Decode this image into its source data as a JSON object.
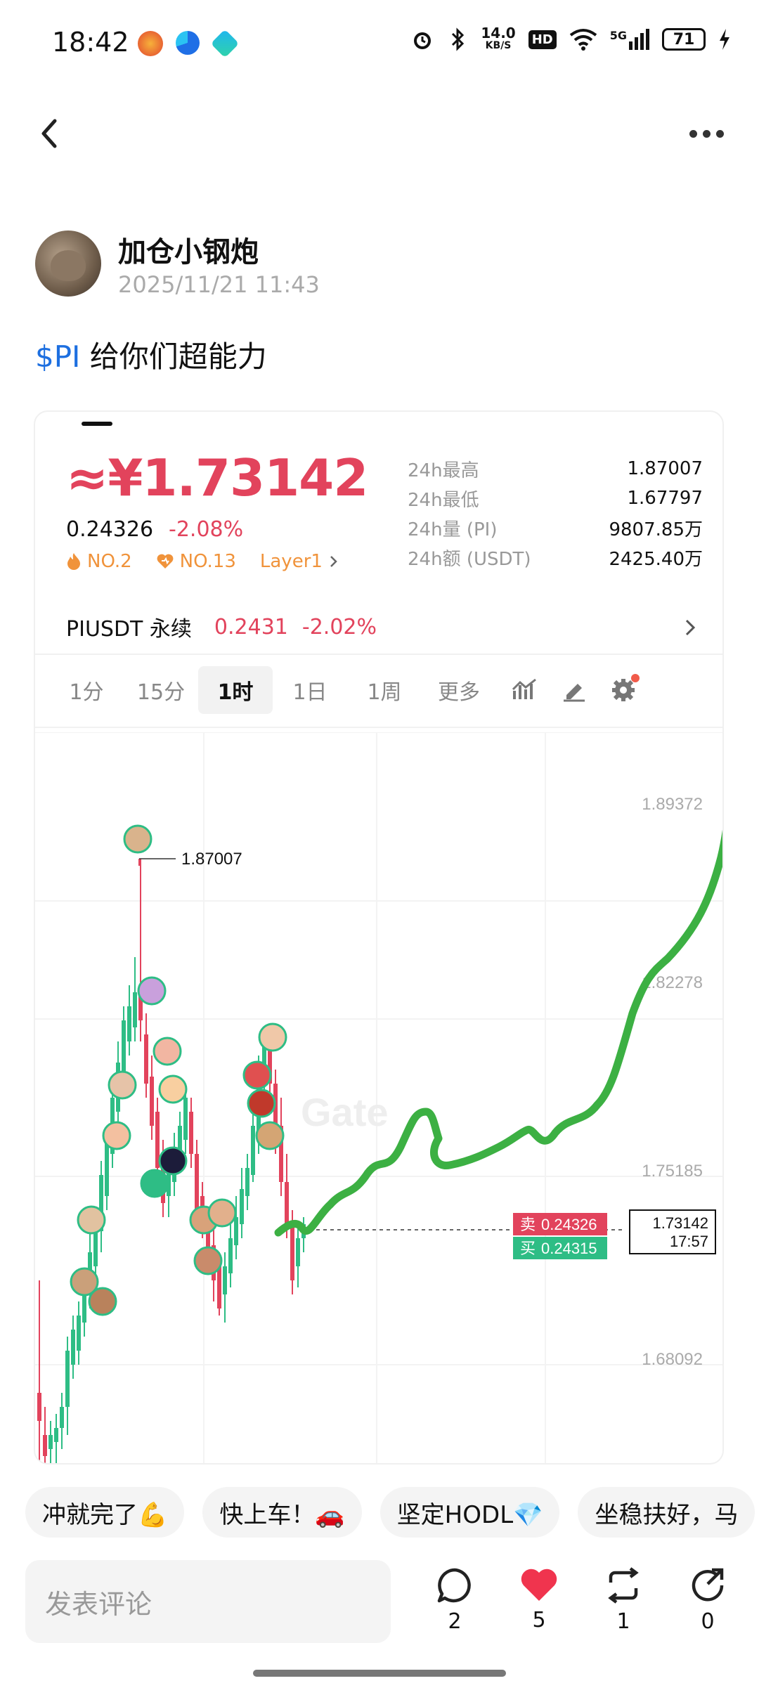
{
  "status_bar": {
    "time": "18:42",
    "net_speed": "14.0",
    "net_unit": "KB/S",
    "hd": "HD",
    "signal": "5G",
    "battery": "71"
  },
  "author": {
    "name": "加仓小钢炮",
    "time": "2025/11/21 11:43"
  },
  "post": {
    "cashtag": "$PI",
    "text": " 给你们超能力"
  },
  "ticker": {
    "price_cny": "≈¥1.73142",
    "price_usd": "0.24326",
    "change": "-2.08%",
    "rank1": "NO.2",
    "rank2": "NO.13",
    "tag": "Layer1",
    "stats": [
      {
        "label": "24h最高",
        "value": "1.87007"
      },
      {
        "label": "24h最低",
        "value": "1.67797"
      },
      {
        "label": "24h量 (PI)",
        "value": "9807.85万"
      },
      {
        "label": "24h额 (USDT)",
        "value": "2425.40万"
      }
    ],
    "perp_name": "PIUSDT 永续",
    "perp_price": "0.2431",
    "perp_change": "-2.02%"
  },
  "interval_tabs": [
    {
      "label": "1分",
      "active": false
    },
    {
      "label": "15分",
      "active": false
    },
    {
      "label": "1时",
      "active": true
    },
    {
      "label": "1日",
      "active": false
    },
    {
      "label": "1周",
      "active": false
    },
    {
      "label": "更多",
      "active": false
    }
  ],
  "chart_data": {
    "type": "candlestick",
    "y_ticks": [
      "1.89372",
      "1.82278",
      "1.75185",
      "1.68092"
    ],
    "high_label": "1.87007",
    "sell_label": "卖",
    "sell_price": "0.24326",
    "buy_label": "买",
    "buy_price": "0.24315",
    "current_price": "1.73142",
    "countdown": "17:57",
    "watermark": "Gate",
    "colors": {
      "up": "#2ebd85",
      "down": "#e2435c",
      "hand_drawn": "#3cb043"
    }
  },
  "quick_replies": [
    "冲就完了💪",
    "快上车！🚗",
    "坚定HODL💎",
    "坐稳扶好，马"
  ],
  "comment_placeholder": "发表评论",
  "actions": [
    {
      "icon": "comment-icon",
      "count": "2"
    },
    {
      "icon": "heart-icon",
      "count": "5"
    },
    {
      "icon": "repost-icon",
      "count": "1"
    },
    {
      "icon": "share-icon",
      "count": "0"
    }
  ]
}
